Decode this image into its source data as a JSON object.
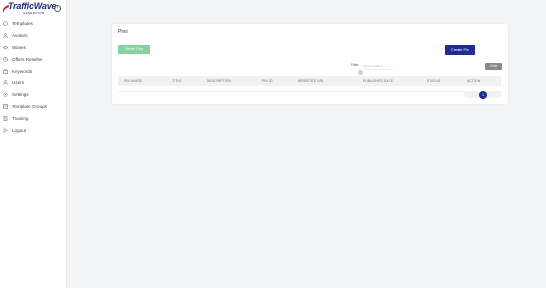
{
  "brand": {
    "name": "TrafficWave",
    "tagline": "GENERATOR",
    "accent": "#1a2e7a"
  },
  "sidebar": {
    "collapse_icon": "chevron-left-icon",
    "items": [
      {
        "label": "Templates",
        "icon": "template-icon"
      },
      {
        "label": "Avatars",
        "icon": "user-icon"
      },
      {
        "label": "Waves",
        "icon": "wave-icon"
      },
      {
        "label": "Offers Reseller",
        "icon": "offers-icon"
      },
      {
        "label": "Keywords",
        "icon": "key-icon"
      },
      {
        "label": "Users",
        "icon": "users-icon"
      },
      {
        "label": "Settings",
        "icon": "settings-icon"
      },
      {
        "label": "Template Groups",
        "icon": "group-icon"
      },
      {
        "label": "Training",
        "icon": "training-icon"
      },
      {
        "label": "Logout",
        "icon": "logout-icon"
      }
    ]
  },
  "main": {
    "title": "Pins",
    "delete_label": "Delete Pins",
    "create_label": "Create Pin",
    "filter_label": "Filter",
    "filter_placeholder": "Type to search",
    "clear_label": "Clear",
    "columns": [
      "PIN IMAGE",
      "TITLE",
      "DESCRIPTION",
      "PIN ID",
      "WEBSITES URL",
      "PUBLISHED DATE",
      "STATUS",
      "ACTION"
    ],
    "current_page": "1"
  },
  "colors": {
    "primary": "#1e2b8f",
    "delete": "#86d3a0",
    "clear": "#8a8a8a"
  }
}
